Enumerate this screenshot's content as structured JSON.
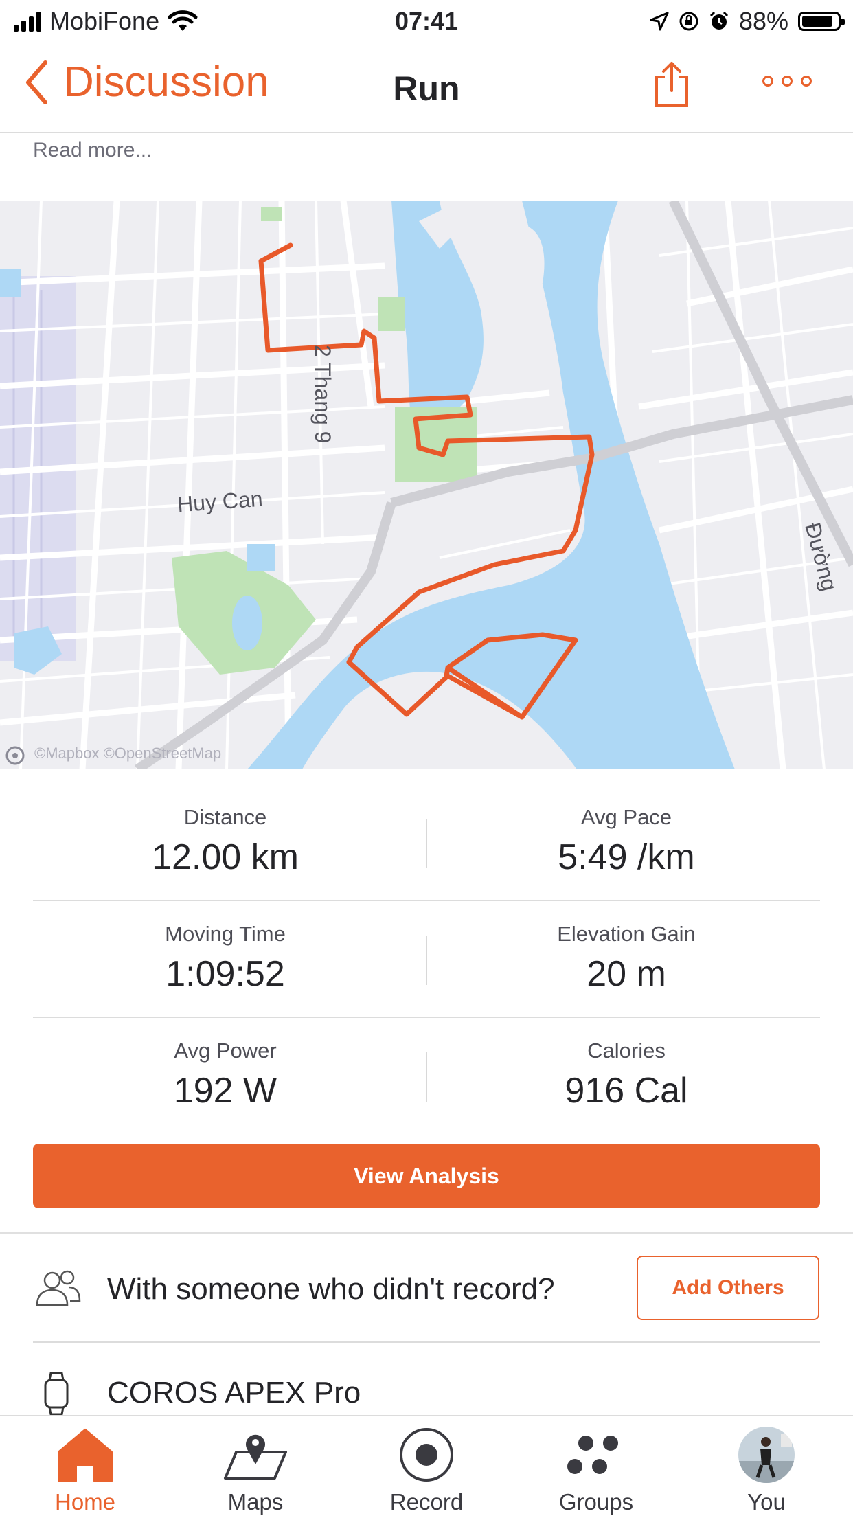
{
  "status_bar": {
    "carrier": "MobiFone",
    "time": "07:41",
    "battery": "88%",
    "battery_level": 0.88
  },
  "nav": {
    "back_label": "Discussion",
    "title": "Run"
  },
  "read_more": "Read more...",
  "map": {
    "street_labels": [
      "Huy Can",
      "2 Thang 9",
      "Đường"
    ],
    "attribution": "©Mapbox ©OpenStreetMap",
    "route_color": "#e8592a"
  },
  "stats": [
    {
      "label": "Distance",
      "value": "12.00 km"
    },
    {
      "label": "Avg Pace",
      "value": "5:49 /km"
    },
    {
      "label": "Moving Time",
      "value": "1:09:52"
    },
    {
      "label": "Elevation Gain",
      "value": "20 m"
    },
    {
      "label": "Avg Power",
      "value": "192 W"
    },
    {
      "label": "Calories",
      "value": "916 Cal"
    }
  ],
  "view_analysis_label": "View Analysis",
  "with_others": {
    "text": "With someone who didn't record?",
    "button": "Add Others"
  },
  "device": "COROS APEX Pro",
  "tabs": [
    {
      "label": "Home",
      "icon": "home-icon",
      "active": true
    },
    {
      "label": "Maps",
      "icon": "maps-icon",
      "active": false
    },
    {
      "label": "Record",
      "icon": "record-icon",
      "active": false
    },
    {
      "label": "Groups",
      "icon": "groups-icon",
      "active": false
    },
    {
      "label": "You",
      "icon": "avatar",
      "active": false
    }
  ],
  "colors": {
    "accent": "#e9622d",
    "water": "#aed8f5",
    "park": "#bfe3b6"
  }
}
